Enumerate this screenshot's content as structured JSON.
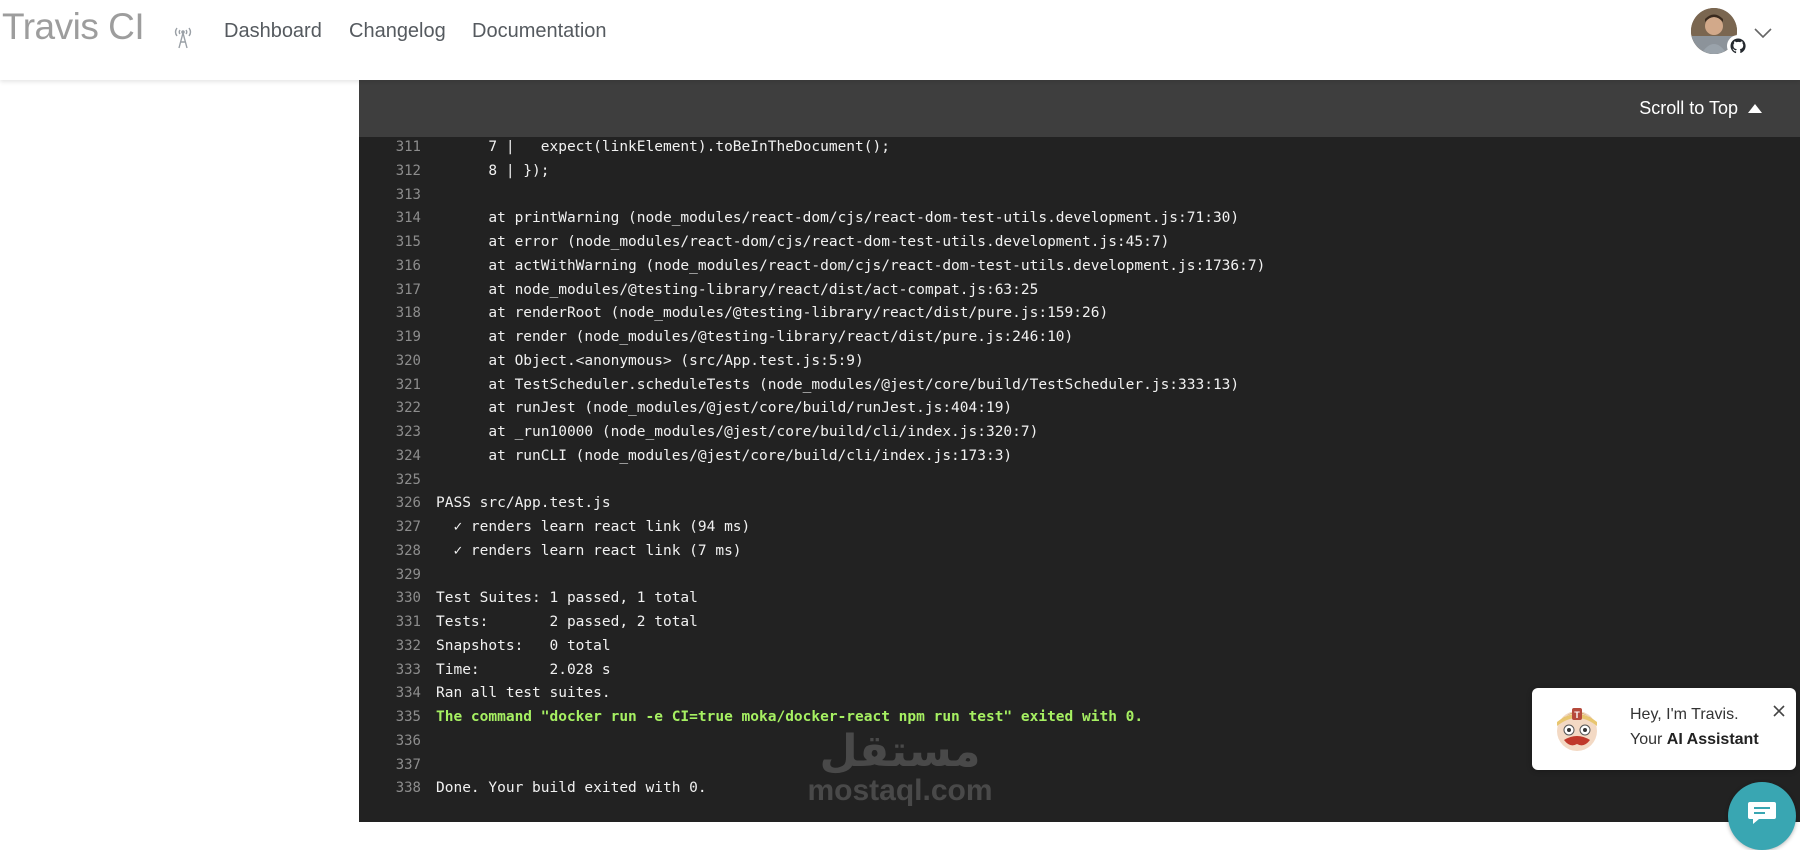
{
  "nav": {
    "brand": "Travis CI",
    "links": [
      "Dashboard",
      "Changelog",
      "Documentation"
    ]
  },
  "log": {
    "scroll_to_top": "Scroll to Top",
    "lines": [
      {
        "n": "311",
        "t": "      7 |   expect(linkElement).toBeInTheDocument();"
      },
      {
        "n": "312",
        "t": "      8 | });"
      },
      {
        "n": "313",
        "t": ""
      },
      {
        "n": "314",
        "t": "      at printWarning (node_modules/react-dom/cjs/react-dom-test-utils.development.js:71:30)"
      },
      {
        "n": "315",
        "t": "      at error (node_modules/react-dom/cjs/react-dom-test-utils.development.js:45:7)"
      },
      {
        "n": "316",
        "t": "      at actWithWarning (node_modules/react-dom/cjs/react-dom-test-utils.development.js:1736:7)"
      },
      {
        "n": "317",
        "t": "      at node_modules/@testing-library/react/dist/act-compat.js:63:25"
      },
      {
        "n": "318",
        "t": "      at renderRoot (node_modules/@testing-library/react/dist/pure.js:159:26)"
      },
      {
        "n": "319",
        "t": "      at render (node_modules/@testing-library/react/dist/pure.js:246:10)"
      },
      {
        "n": "320",
        "t": "      at Object.<anonymous> (src/App.test.js:5:9)"
      },
      {
        "n": "321",
        "t": "      at TestScheduler.scheduleTests (node_modules/@jest/core/build/TestScheduler.js:333:13)"
      },
      {
        "n": "322",
        "t": "      at runJest (node_modules/@jest/core/build/runJest.js:404:19)"
      },
      {
        "n": "323",
        "t": "      at _run10000 (node_modules/@jest/core/build/cli/index.js:320:7)"
      },
      {
        "n": "324",
        "t": "      at runCLI (node_modules/@jest/core/build/cli/index.js:173:3)"
      },
      {
        "n": "325",
        "t": ""
      },
      {
        "n": "326",
        "t": "PASS src/App.test.js"
      },
      {
        "n": "327",
        "t": "  ✓ renders learn react link (94 ms)"
      },
      {
        "n": "328",
        "t": "  ✓ renders learn react link (7 ms)"
      },
      {
        "n": "329",
        "t": ""
      },
      {
        "n": "330",
        "t": "Test Suites: 1 passed, 1 total"
      },
      {
        "n": "331",
        "t": "Tests:       2 passed, 2 total"
      },
      {
        "n": "332",
        "t": "Snapshots:   0 total"
      },
      {
        "n": "333",
        "t": "Time:        2.028 s"
      },
      {
        "n": "334",
        "t": "Ran all test suites."
      },
      {
        "n": "335",
        "t": "The command \"docker run -e CI=true moka/docker-react npm run test\" exited with 0.",
        "green": true
      },
      {
        "n": "336",
        "t": ""
      },
      {
        "n": "337",
        "t": ""
      },
      {
        "n": "338",
        "t": "Done. Your build exited with 0."
      }
    ]
  },
  "watermark": {
    "arabic": "مستقل",
    "latin": "mostaql.com"
  },
  "assistant": {
    "greeting": "Hey, I'm Travis.",
    "your": "Your ",
    "role": "AI Assistant"
  },
  "colors": {
    "log_bg": "#222222",
    "log_header_bg": "#3e3e3e",
    "success_green": "#a6f062",
    "chat_teal": "#39a6b2"
  },
  "icons": [
    "antenna-icon",
    "avatar",
    "github-icon",
    "chevron-down-icon",
    "caret-up-icon",
    "mascot-icon",
    "close-icon",
    "chat-icon"
  ]
}
